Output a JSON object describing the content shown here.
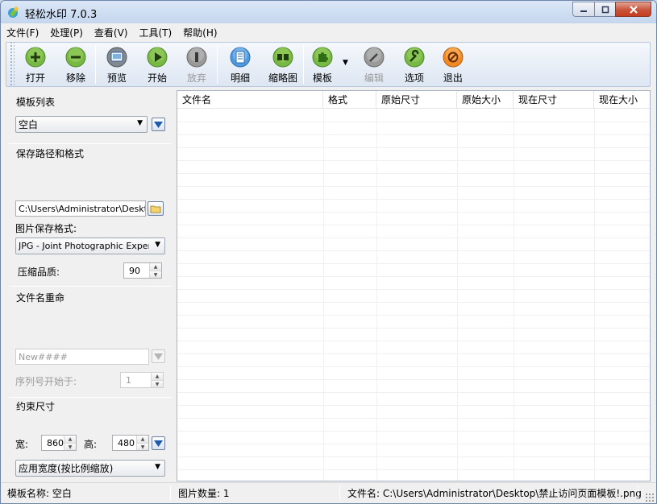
{
  "window": {
    "title": "轻松水印 7.0.3"
  },
  "menu": [
    "文件(F)",
    "处理(P)",
    "查看(V)",
    "工具(T)",
    "帮助(H)"
  ],
  "toolbar": {
    "open": "打开",
    "remove": "移除",
    "preview": "预览",
    "start": "开始",
    "abort": "放弃",
    "detail": "明细",
    "thumbnail": "缩略图",
    "template": "模板",
    "edit": "编辑",
    "options": "选项",
    "exit": "退出"
  },
  "colors": {
    "green": "#6cb33f",
    "gray": "#8a8a8a",
    "blue": "#4f9ae0",
    "orange": "#f08a24"
  },
  "left": {
    "template_list_title": "模板列表",
    "template_selected": "空白",
    "save_title": "保存路径和格式",
    "save_path": "C:\\Users\\Administrator\\Desktop\\",
    "format_label": "图片保存格式:",
    "format_selected": "JPG - Joint Photographic Experts Group",
    "quality_label": "压缩品质:",
    "quality_value": "90",
    "rename_title": "文件名重命",
    "rename_pattern": "New####",
    "seq_label": "序列号开始于:",
    "seq_value": "1",
    "size_title": "约束尺寸",
    "width_label": "宽:",
    "width_value": "860",
    "height_label": "高:",
    "height_value": "480",
    "size_mode": "应用宽度(按比例缩放)"
  },
  "grid": {
    "columns": [
      "文件名",
      "格式",
      "原始尺寸",
      "原始大小",
      "现在尺寸",
      "现在大小"
    ]
  },
  "status": {
    "template_name": "模板名称: 空白",
    "image_count": "图片数量: 1",
    "file_name": "文件名: C:\\Users\\Administrator\\Desktop\\禁止访问页面模板!.png"
  }
}
